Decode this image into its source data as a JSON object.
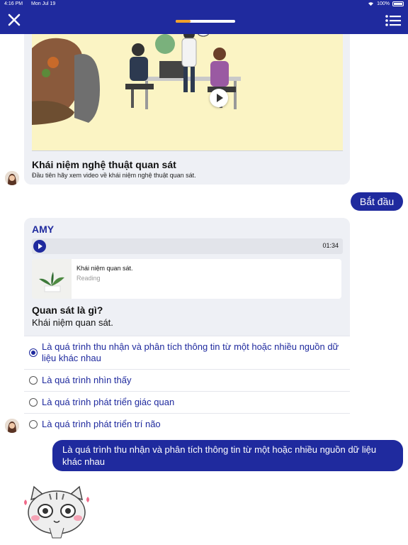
{
  "status_bar": {
    "time": "4:16 PM",
    "date": "Mon Jul 19",
    "battery": "100%"
  },
  "header": {
    "progress": 0.25,
    "progress_color": "#f0a02a",
    "accent": "#1f2a9e"
  },
  "video": {
    "title": "Khái niệm nghệ thuật quan sát",
    "description": "Đầu tiên hãy xem video về khái niệm nghệ thuật quan sát."
  },
  "user_reply_start": "Bắt đầu",
  "amy_card": {
    "sender": "AMY",
    "audio_time": "01:34",
    "reading": {
      "title": "Khái niệm quan sát.",
      "type": "Reading"
    },
    "question_title": "Quan sát là gì?",
    "question_sub": "Khái niệm quan sát.",
    "options": [
      {
        "label": "Là quá trình thu nhận và phân tích thông tin từ một hoặc nhiều nguồn dữ liệu khác nhau",
        "selected": true
      },
      {
        "label": "Là quá trình nhìn thấy",
        "selected": false
      },
      {
        "label": "Là quá trình phát triển giác quan",
        "selected": false
      },
      {
        "label": "Là quá trình phát triển trí não",
        "selected": false
      }
    ]
  },
  "user_reply_answer": "Là quá trình thu nhận và phân tích thông tin từ một hoặc nhiều nguồn dữ liệu khác nhau",
  "icons": [
    "close-icon",
    "menu-list-icon",
    "play-icon",
    "battery-icon",
    "wifi-icon",
    "radio-icon"
  ]
}
